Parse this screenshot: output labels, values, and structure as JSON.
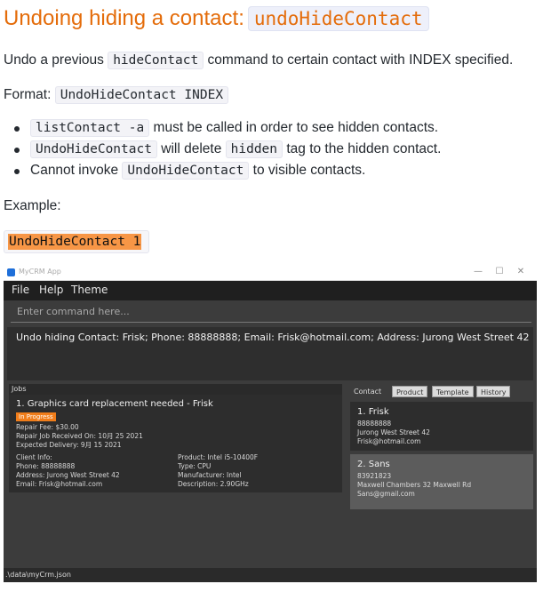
{
  "doc": {
    "heading": "Undoing hiding a contact:",
    "heading_code": "undoHideContact",
    "intro_before": "Undo a previous",
    "intro_code": "hideContact",
    "intro_after": "command to certain contact with INDEX specified.",
    "format_label": "Format:",
    "format_code": "UndoHideContact INDEX",
    "bullets": [
      {
        "code": "listContact -a",
        "text": "must be called in order to see hidden contacts."
      },
      {
        "code1": "UndoHideContact",
        "mid": "will delete",
        "code2": "hidden",
        "text": "tag to the hidden contact."
      },
      {
        "before": "Cannot invoke",
        "code": "UndoHideContact",
        "text": "to visible contacts."
      }
    ],
    "example_label": "Example:",
    "example_code": "UndoHideContact 1"
  },
  "app": {
    "title": "MyCRM App",
    "window_controls": [
      "—",
      "☐",
      "✕"
    ],
    "menu": [
      "File",
      "Help",
      "Theme"
    ],
    "command_placeholder": "Enter command here...",
    "result_text": "Undo hiding Contact: Frisk; Phone: 88888888; Email: Frisk@hotmail.com; Address: Jurong West Street 42",
    "jobs_header": "Jobs",
    "job": {
      "title": "1.  Graphics card replacement needed  -  Frisk",
      "status": "In Progress",
      "fee": "Repair Fee: $30.00",
      "received": "Repair Job Received On: 10月 25 2021",
      "delivery": "Expected Delivery: 9月 15 2021",
      "client_label": "Client Info:",
      "client_phone": "Phone: 88888888",
      "client_address": "Address: Jurong West Street 42",
      "client_email": "Email: Frisk@hotmail.com",
      "product": "Product: Intel i5-10400F",
      "type": "Type: CPU",
      "manufacturer": "Manufacturer: Intel",
      "description": "Description: 2.90GHz"
    },
    "tabs": [
      "Contact",
      "Product",
      "Template",
      "History"
    ],
    "contacts": [
      {
        "name": "1.  Frisk",
        "phone": "88888888",
        "address": "Jurong West Street 42",
        "email": "Frisk@hotmail.com"
      },
      {
        "name": "2.  Sans",
        "phone": "83921823",
        "address": "Maxwell Chambers 32 Maxwell Rd",
        "email": "Sans@gmail.com"
      }
    ],
    "status_bar": ".\\data\\myCrm.json"
  }
}
